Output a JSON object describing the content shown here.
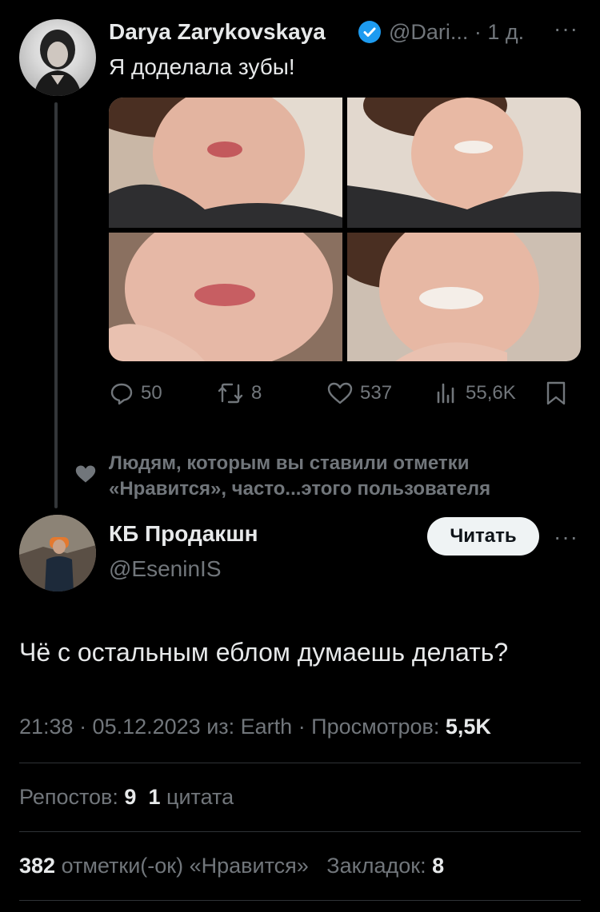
{
  "tweet": {
    "author_name": "Darya Zarykovskaya",
    "handle_time": "@Dari... · 1 д.",
    "more": "···",
    "text": "Я доделала зубы!",
    "images": [
      "photo-1",
      "photo-2",
      "photo-3",
      "photo-4"
    ],
    "actions": {
      "replies": "50",
      "reposts": "8",
      "likes": "537",
      "views": "55,6K"
    }
  },
  "liked_notice": "Людям, которым вы ставили отметки «Нравится», часто...этого пользователя",
  "reply": {
    "author_name": "КБ Продакшн",
    "handle": "@EseninIS",
    "follow_label": "Читать",
    "more": "···",
    "text": "Чё с остальным еблом думаешь делать?",
    "timestamp": "21:38 · 05.12.2023 из: Earth · Просмотров: ",
    "views": "5,5K",
    "reposts_label": "Репостов: ",
    "reposts_count": "9",
    "quotes_count": "1",
    "quotes_label": " цитата",
    "likes_count": "382",
    "likes_label": " отметки(-ок) «Нравится»",
    "bookmarks_label": "Закладок: ",
    "bookmarks_count": "8"
  },
  "colors": {
    "background": "#000000",
    "text": "#e7e9ea",
    "muted": "#71767b",
    "verified": "#1d9bf0",
    "divider": "#2f3336"
  }
}
